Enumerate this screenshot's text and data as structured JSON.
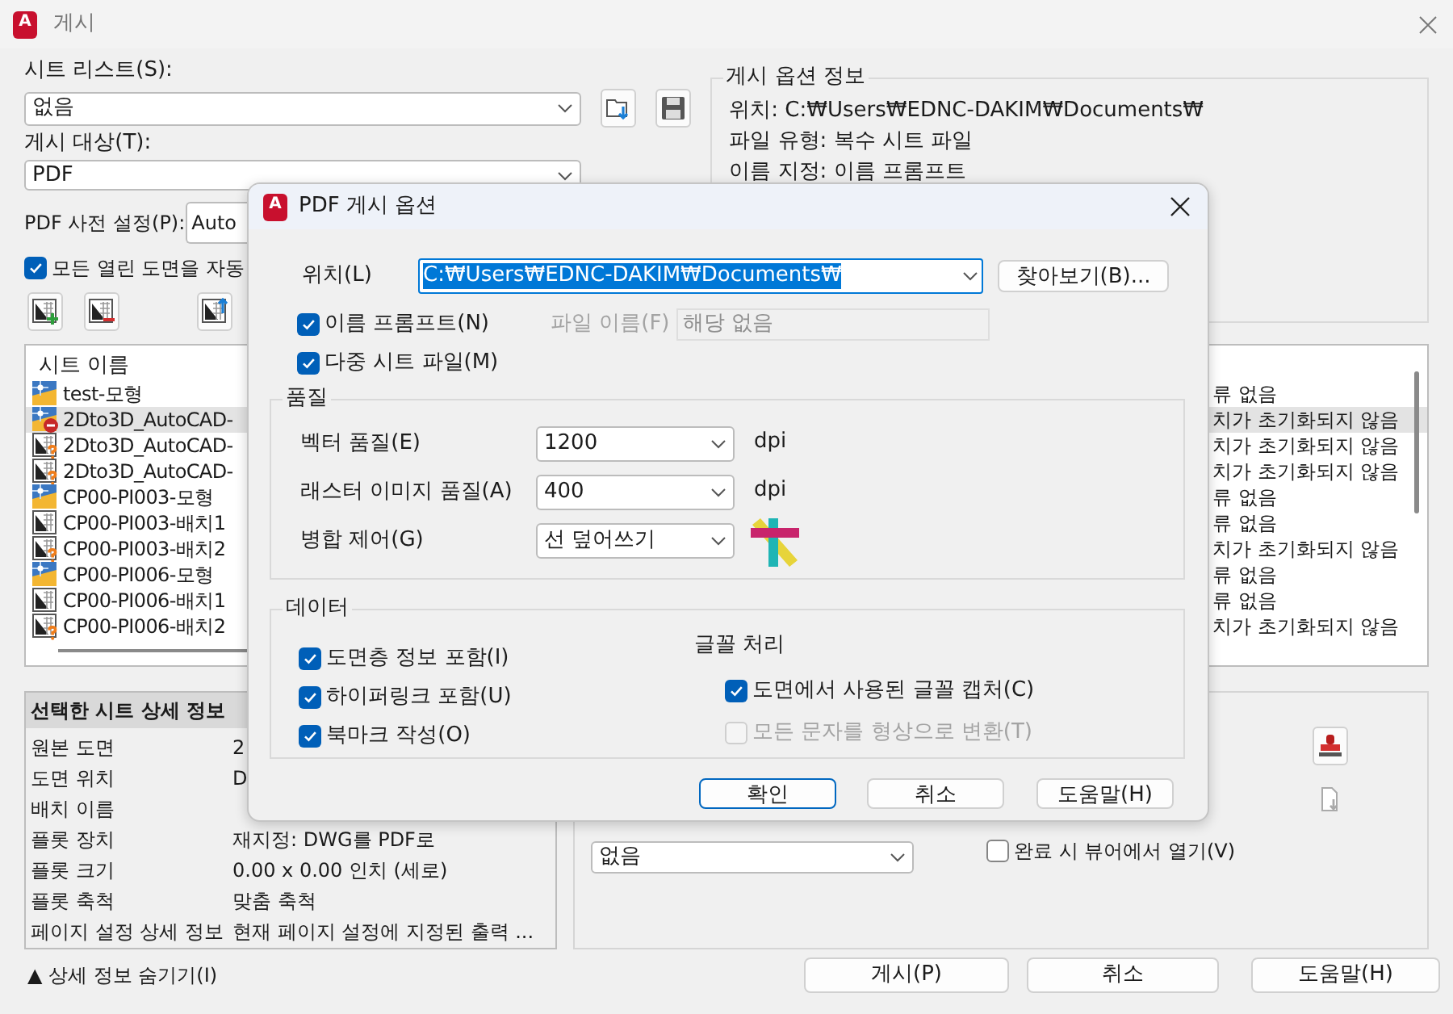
{
  "window": {
    "icon_letter": "A",
    "title": "게시"
  },
  "sheet_list": {
    "label": "시트 리스트(S):",
    "value": "없음"
  },
  "publish_to": {
    "label": "게시 대상(T):",
    "value": "PDF"
  },
  "pdf_preset": {
    "label": "PDF 사전 설정(P):",
    "value": "Auto"
  },
  "auto_load": {
    "label": "모든 열린 도면을 자동",
    "checked": true
  },
  "publish_options_info": {
    "title": "게시 옵션 정보",
    "lines": [
      "위치: C:₩Users₩EDNC-DAKIM₩Documents₩",
      "파일 유형: 복수 시트 파일",
      "이름 지정: 이름 프롬프트"
    ]
  },
  "sheets": {
    "columns": [
      "시트 이름"
    ],
    "rows": [
      {
        "name": "test-모형",
        "kind": "model",
        "status": "류 없음",
        "selected": false
      },
      {
        "name": "2Dto3D_AutoCAD-",
        "kind": "model-error",
        "status": "치가 초기화되지 않음",
        "selected": true
      },
      {
        "name": "2Dto3D_AutoCAD-",
        "kind": "layout-missing",
        "status": "치가 초기화되지 않음",
        "selected": false
      },
      {
        "name": "2Dto3D_AutoCAD-",
        "kind": "layout-missing",
        "status": "치가 초기화되지 않음",
        "selected": false
      },
      {
        "name": "CP00-PI003-모형",
        "kind": "model",
        "status": "류 없음",
        "selected": false
      },
      {
        "name": "CP00-PI003-배치1",
        "kind": "layout",
        "status": "류 없음",
        "selected": false
      },
      {
        "name": "CP00-PI003-배치2",
        "kind": "layout-missing",
        "status": "치가 초기화되지 않음",
        "selected": false
      },
      {
        "name": "CP00-PI006-모형",
        "kind": "model",
        "status": "류 없음",
        "selected": false
      },
      {
        "name": "CP00-PI006-배치1",
        "kind": "layout",
        "status": "류 없음",
        "selected": false
      },
      {
        "name": "CP00-PI006-배치2",
        "kind": "layout-missing",
        "status": "치가 초기화되지 않음",
        "selected": false
      }
    ]
  },
  "details": {
    "title": "선택한 시트 상세 정보",
    "rows": [
      {
        "label": "원본 도면",
        "value": "2"
      },
      {
        "label": "도면 위치",
        "value": "D"
      },
      {
        "label": "배치 이름"
      },
      {
        "label": "플롯 장치",
        "value": "재지정: DWG를 PDF로"
      },
      {
        "label": "플롯 크기",
        "value": "0.00 x 0.00 인치 (세로)"
      },
      {
        "label": "플롯 축척",
        "value": "맞춤 축척"
      },
      {
        "label": "페이지 설정 상세 정보",
        "value": "현재 페이지 설정에 지정된 출력 ..."
      }
    ]
  },
  "output": {
    "dropdown": "없음",
    "open_in_viewer": {
      "label": "완료 시 뷰어에서 열기(V)",
      "checked": false
    }
  },
  "toggle_details": "▲ 상세 정보 숨기기(I)",
  "buttons": [
    "게시(P)",
    "취소",
    "도움말(H)"
  ],
  "dialog": {
    "icon_letter": "A",
    "title": "PDF 게시 옵션",
    "location": {
      "label": "위치(L)",
      "value": "C:₩Users₩EDNC-DAKIM₩Documents₩"
    },
    "browse": "찾아보기(B)...",
    "name_prompt": {
      "label": "이름 프롬프트(N)",
      "checked": true
    },
    "file_name": {
      "label": "파일 이름(F)",
      "value": "해당 없음",
      "disabled": true
    },
    "multi_sheet": {
      "label": "다중 시트 파일(M)",
      "checked": true
    },
    "quality": {
      "title": "품질",
      "rows": [
        {
          "label": "벡터 품질(E)",
          "value": "1200",
          "unit": "dpi"
        },
        {
          "label": "래스터 이미지 품질(A)",
          "value": "400",
          "unit": "dpi"
        },
        {
          "label": "병합 제어(G)",
          "value": "선 덮어쓰기"
        }
      ]
    },
    "data": {
      "title": "데이터",
      "options": [
        {
          "label": "도면층 정보 포함(I)",
          "checked": true
        },
        {
          "label": "하이퍼링크 포함(U)",
          "checked": true
        },
        {
          "label": "북마크 작성(O)",
          "checked": true
        }
      ]
    },
    "fonts": {
      "title": "글꼴 처리",
      "options": [
        {
          "label": "도면에서 사용된 글꼴 캡처(C)",
          "checked": true,
          "disabled": false
        },
        {
          "label": "모든 문자를 형상으로 변환(T)",
          "checked": false,
          "disabled": true
        }
      ]
    },
    "buttons": [
      {
        "label": "확인",
        "default": true
      },
      {
        "label": "취소",
        "default": false
      },
      {
        "label": "도움말(H)",
        "default": false
      }
    ]
  }
}
